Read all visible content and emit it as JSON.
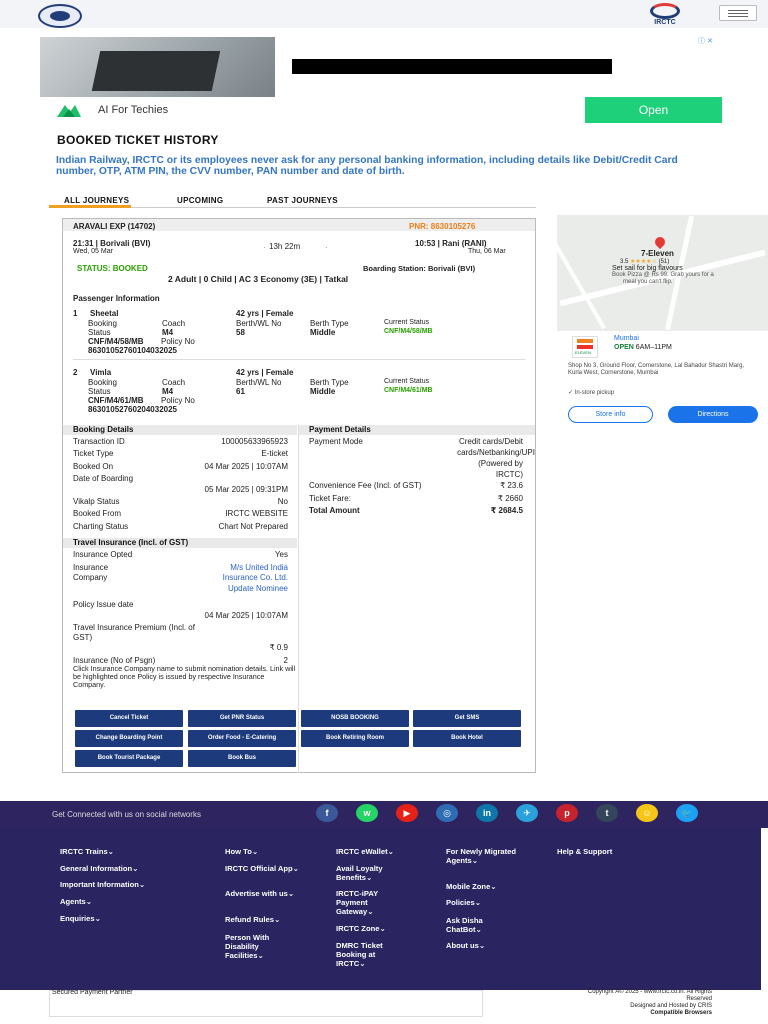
{
  "header": {
    "irctc_logo_text": "IRCTC"
  },
  "ad": {
    "close_label": "ⓘ ✕",
    "brand_text": "AI For Techies",
    "open_label": "Open"
  },
  "page": {
    "title": "BOOKED TICKET HISTORY",
    "warning": "Indian Railway, IRCTC or its employees never ask for any personal banking information, including details like Debit/Credit Card number, OTP, ATM PIN, the CVV number, PAN number and date of birth."
  },
  "tabs": [
    "ALL JOURNEYS",
    "UPCOMING",
    "PAST JOURNEYS"
  ],
  "ticket": {
    "train": "ARAVALI EXP (14702)",
    "pnr": "PNR: 8630105276",
    "dep_time": "21:31 | Borivali (BVI)",
    "dep_date": "Wed, 05 Mar",
    "duration": "13h 22m",
    "arr_time": "10:53 | Rani (RANI)",
    "arr_date": "Thu, 06 Mar",
    "status": "STATUS: BOOKED",
    "boarding": "Boarding Station: Borivali (BVI)",
    "summary": "2 Adult | 0 Child | AC 3 Economy (3E) | Tatkal",
    "passenger_heading": "Passenger Information",
    "passengers": [
      {
        "no": "1",
        "name": "Sheetal",
        "age": "42 yrs | Female",
        "lbl_booking": "Booking",
        "lbl_status": "Status",
        "lbl_coach": "Coach",
        "coach": "M4",
        "lbl_berth": "Berth/WL No",
        "berth": "58",
        "lbl_type": "Berth Type",
        "type": "Middle",
        "lbl_current": "Current Status",
        "current": "CNF/M4/58/MB",
        "booking_status": "CNF/M4/58/MB",
        "policy_label": "Policy No",
        "policy": "86301052760104032025"
      },
      {
        "no": "2",
        "name": "Vimla",
        "age": "42 yrs | Female",
        "lbl_booking": "Booking",
        "lbl_status": "Status",
        "lbl_coach": "Coach",
        "coach": "M4",
        "lbl_berth": "Berth/WL No",
        "berth": "61",
        "lbl_type": "Berth Type",
        "type": "Middle",
        "lbl_current": "Current Status",
        "current": "CNF/M4/61/MB",
        "booking_status": "CNF/M4/61/MB",
        "policy_label": "Policy No",
        "policy": "86301052760204032025"
      }
    ],
    "booking_details": {
      "heading": "Booking Details",
      "txn_label": "Transaction ID",
      "txn": "100005633965923",
      "type_label": "Ticket Type",
      "type": "E-ticket",
      "booked_label": "Booked On",
      "booked": "04 Mar 2025 | 10:07AM",
      "doj_label": "Date of Boarding",
      "doj": "05 Mar 2025 | 09:31PM",
      "vikalp_label": "Vikalp Status",
      "vikalp": "No",
      "from_label": "Booked From",
      "from": "IRCTC WEBSITE",
      "chart_label": "Charting Status",
      "chart": "Chart Not Prepared"
    },
    "payment_details": {
      "heading": "Payment Details",
      "mode_label": "Payment Mode",
      "mode_1": "Credit cards/Debit",
      "mode_2": "cards/Netbanking/UPI",
      "mode_3": "(Powered by",
      "mode_4": "IRCTC)",
      "fee_label": "Convenience Fee (Incl. of GST)",
      "fee": "₹ 23.6",
      "fare_label": "Ticket Fare:",
      "fare": "₹ 2660",
      "total_label": "Total Amount",
      "total": "₹ 2684.5"
    },
    "insurance": {
      "heading": "Travel Insurance (Incl. of GST)",
      "opted_label": "Insurance Opted",
      "opted": "Yes",
      "company_label_1": "Insurance",
      "company_label_2": "Company",
      "company_1": "M/s United India",
      "company_2": "Insurance Co. Ltd.",
      "update_link": "Update Nominee",
      "issue_label": "Policy Issue date",
      "issue": "04 Mar 2025 | 10:07AM",
      "premium_label_1": "Travel Insurance Premium (Incl. of",
      "premium_label_2": "GST)",
      "premium": "₹ 0.9",
      "psgn_label": "Insurance (No of Psgn)",
      "psgn": "2",
      "note": "Click Insurance Company name to submit nomination details. Link will be highlighted once Policy is issued by respective Insurance Company."
    },
    "buttons": [
      "Cancel Ticket",
      "Get PNR Status",
      "NOSB BOOKING",
      "Get SMS",
      "Change Boarding Point",
      "Order Food - E-Catering",
      "Book Retiring Room",
      "Book Hotel",
      "Book Tourist Package",
      "Book Bus"
    ]
  },
  "map_ad": {
    "store": "7-Eleven",
    "rating": "3.5",
    "stars": "★★★★☆",
    "reviews": "(51)",
    "tagline_1": "Set sail for big flavours",
    "tagline_2": "Book Pizza @ Rs 99. Grab yours for a",
    "tagline_3": "meal you can't flip.",
    "city": "Mumbai",
    "open_label": "OPEN",
    "hours": "6AM–11PM",
    "address": "Shop No 3, Ground Floor, Cornerstone, Lal Bahadur Shastri Marg, Kurla West, Cornerstone, Mumbai",
    "pickup": "In-store pickup",
    "store_info": "Store info",
    "directions": "Directions",
    "logo_text": "ELEVEN"
  },
  "footer": {
    "social_text": "Get Connected with us on social networks",
    "social_icons": [
      "f",
      "w",
      "▶",
      "◎",
      "in",
      "✈",
      "p",
      "t",
      "☺",
      "🐦"
    ],
    "col1": [
      "IRCTC Trains⌄",
      "General Information⌄",
      "Important Information⌄",
      "Agents⌄",
      "Enquiries⌄"
    ],
    "col2": [
      "How To⌄",
      "IRCTC Official App⌄",
      "Advertise with us⌄",
      "Refund Rules⌄",
      "Person With Disability Facilities⌄"
    ],
    "col3": [
      "IRCTC eWallet⌄",
      "Avail Loyalty Benefits⌄",
      "IRCTC-iPAY Payment Gateway⌄",
      "IRCTC Zone⌄",
      "DMRC Ticket Booking at IRCTC⌄"
    ],
    "col4": [
      "For Newly Migrated Agents⌄",
      "Mobile Zone⌄",
      "Policies⌄",
      "Ask Disha ChatBot⌄",
      "About us⌄"
    ],
    "col5": [
      "Help & Support"
    ],
    "secured": "Secured Payment Partner",
    "copyright_1": "Copyright Â© 2025 - www.irctc.co.in. All Rights",
    "copyright_2": "Reserved",
    "hosted": "Designed and Hosted by CRIS",
    "compatible": "Compatible Browsers"
  }
}
